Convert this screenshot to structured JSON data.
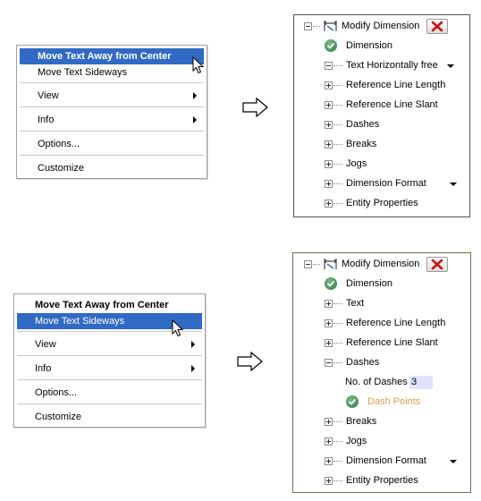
{
  "menu_top": {
    "items": [
      {
        "label": "Move Text Away from Center",
        "bold": true,
        "highlighted": true
      },
      {
        "label": "Move Text Sideways"
      },
      {
        "label": "View",
        "submenu": true
      },
      {
        "label": "Info",
        "submenu": true
      },
      {
        "label": "Options..."
      },
      {
        "label": "Customize"
      }
    ]
  },
  "menu_bottom": {
    "items": [
      {
        "label": "Move Text Away from Center",
        "bold": true
      },
      {
        "label": "Move Text Sideways",
        "highlighted": true
      },
      {
        "label": "View",
        "submenu": true
      },
      {
        "label": "Info",
        "submenu": true
      },
      {
        "label": "Options..."
      },
      {
        "label": "Customize"
      }
    ]
  },
  "panel_top": {
    "title": "Modify Dimension",
    "dimension_label": "Dimension",
    "text_mode": "Text Horizontally free",
    "items": [
      "Reference Line Length",
      "Reference Line Slant",
      "Dashes",
      "Breaks",
      "Jogs",
      "Dimension Format",
      "Entity Properties"
    ]
  },
  "panel_bottom": {
    "title": "Modify Dimension",
    "dimension_label": "Dimension",
    "text_label": "Text",
    "ref_length": "Reference Line Length",
    "ref_slant": "Reference Line Slant",
    "dashes": "Dashes",
    "dashes_count_label": "No. of Dashes",
    "dashes_count_value": "3",
    "dash_points": "Dash Points",
    "breaks": "Breaks",
    "jogs": "Jogs",
    "dimension_format": "Dimension Format",
    "entity_properties": "Entity Properties"
  },
  "colors": {
    "highlight": "#316ac5",
    "dash_points": "#d9a050",
    "close_red": "#cc1111"
  }
}
